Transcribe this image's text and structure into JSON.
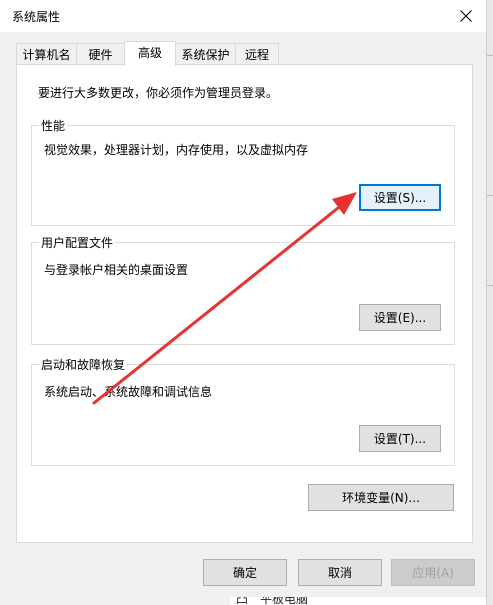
{
  "window": {
    "title": "系统属性"
  },
  "tabs": [
    {
      "label": "计算机名",
      "active": false
    },
    {
      "label": "硬件",
      "active": false
    },
    {
      "label": "高级",
      "active": true
    },
    {
      "label": "系统保护",
      "active": false
    },
    {
      "label": "远程",
      "active": false
    }
  ],
  "notice": "要进行大多数更改，你必须作为管理员登录。",
  "performance": {
    "title": "性能",
    "description": "视觉效果，处理器计划，内存使用，以及虚拟内存",
    "button": "设置(S)..."
  },
  "profiles": {
    "title": "用户配置文件",
    "description": "与登录帐户相关的桌面设置",
    "button": "设置(E)..."
  },
  "startup": {
    "title": "启动和故障恢复",
    "description": "系统启动、系统故障和调试信息",
    "button": "设置(T)..."
  },
  "env_button": "环境变量(N)...",
  "footer": {
    "ok": "确定",
    "cancel": "取消",
    "apply": "应用(A)"
  },
  "background_text": "凸　平板电脑",
  "colors": {
    "accent": "#0078d7",
    "annotation_arrow": "#e8312f"
  }
}
